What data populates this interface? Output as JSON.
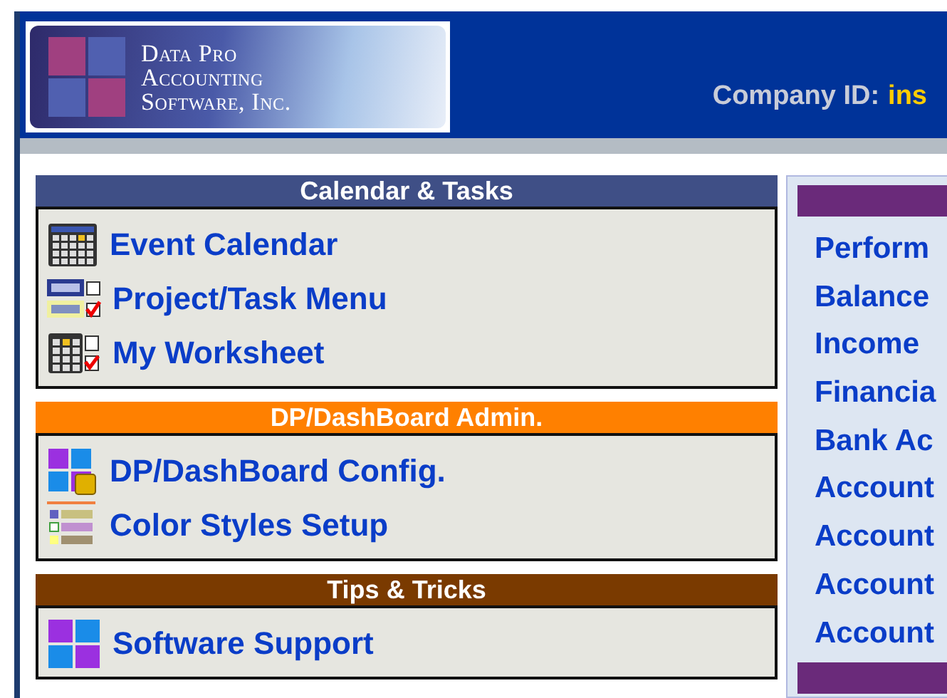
{
  "logo": {
    "lines": [
      "Data Pro",
      "Accounting",
      "Software, Inc."
    ]
  },
  "company": {
    "label": "Company ID:",
    "value": "ins"
  },
  "sections": [
    {
      "title": "Calendar & Tasks",
      "color": "#3f4f86",
      "items": [
        {
          "label": "Event Calendar",
          "kind": "calendar"
        },
        {
          "label": "Project/Task Menu",
          "kind": "task"
        },
        {
          "label": "My Worksheet",
          "kind": "worksheet"
        }
      ]
    },
    {
      "title": "DP/DashBoard Admin.",
      "color": "#ff8000",
      "items": [
        {
          "label": "DP/DashBoard Config.",
          "kind": "dashboard"
        },
        {
          "label": "Color Styles Setup",
          "kind": "styles"
        }
      ]
    },
    {
      "title": "Tips & Tricks",
      "color": "#7a3a00",
      "items": [
        {
          "label": "Software Support",
          "kind": "support"
        }
      ]
    }
  ],
  "right_panel": {
    "items": [
      "Perform",
      "Balance",
      "Income",
      "Financia",
      "Bank Ac",
      "Account",
      "Account",
      "Account",
      "Account"
    ]
  }
}
